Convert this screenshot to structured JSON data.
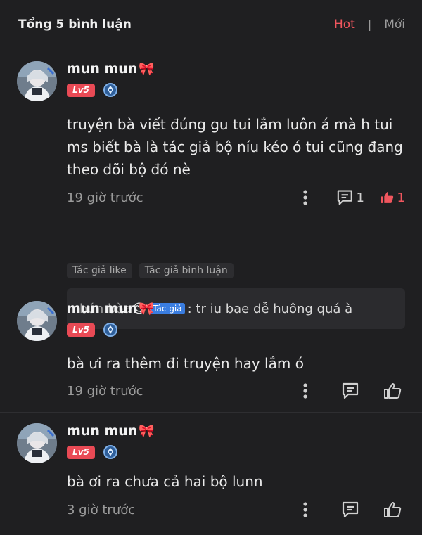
{
  "header": {
    "title": "Tổng 5 bình luận",
    "tab_hot": "Hot",
    "separator": "|",
    "tab_new": "Mới"
  },
  "colors": {
    "accent": "#f0565e",
    "level_badge": "#e94a55",
    "author_badge": "#3a7de0",
    "background": "#1f1f21"
  },
  "comments": [
    {
      "name": "mun mun",
      "name_emoji": "🎀",
      "level": "Lv5",
      "text": "truyện bà viết đúng gu tui lắm luôn á mà h tui ms biết bà là tác giả bộ níu kéo ó tui cũng đang theo dõi bộ đó nè",
      "time": "19 giờ trước",
      "reply_count": "1",
      "like_count": "1",
      "liked": true,
      "tags": [
        "Tác giả like",
        "Tác giả bình luận"
      ],
      "reply": {
        "name": "bún bòa",
        "emoji": "😋",
        "badge": "Tác giả",
        "text": ": tr iu bae dễ huông quá à"
      }
    },
    {
      "name": "mun mun",
      "name_emoji": "🎀",
      "level": "Lv5",
      "text": "bà ưi ra thêm đi truyện hay lắm ó",
      "time": "19 giờ trước",
      "liked": false
    },
    {
      "name": "mun mun",
      "name_emoji": "🎀",
      "level": "Lv5",
      "text": "bà ơi ra chưa cả hai bộ lunn",
      "time": "3 giờ trước",
      "liked": false
    }
  ],
  "icons": {
    "more": "more-vertical-icon",
    "reply": "comment-bubble-icon",
    "like": "thumbs-up-icon",
    "rank": "rank-medal-icon"
  }
}
